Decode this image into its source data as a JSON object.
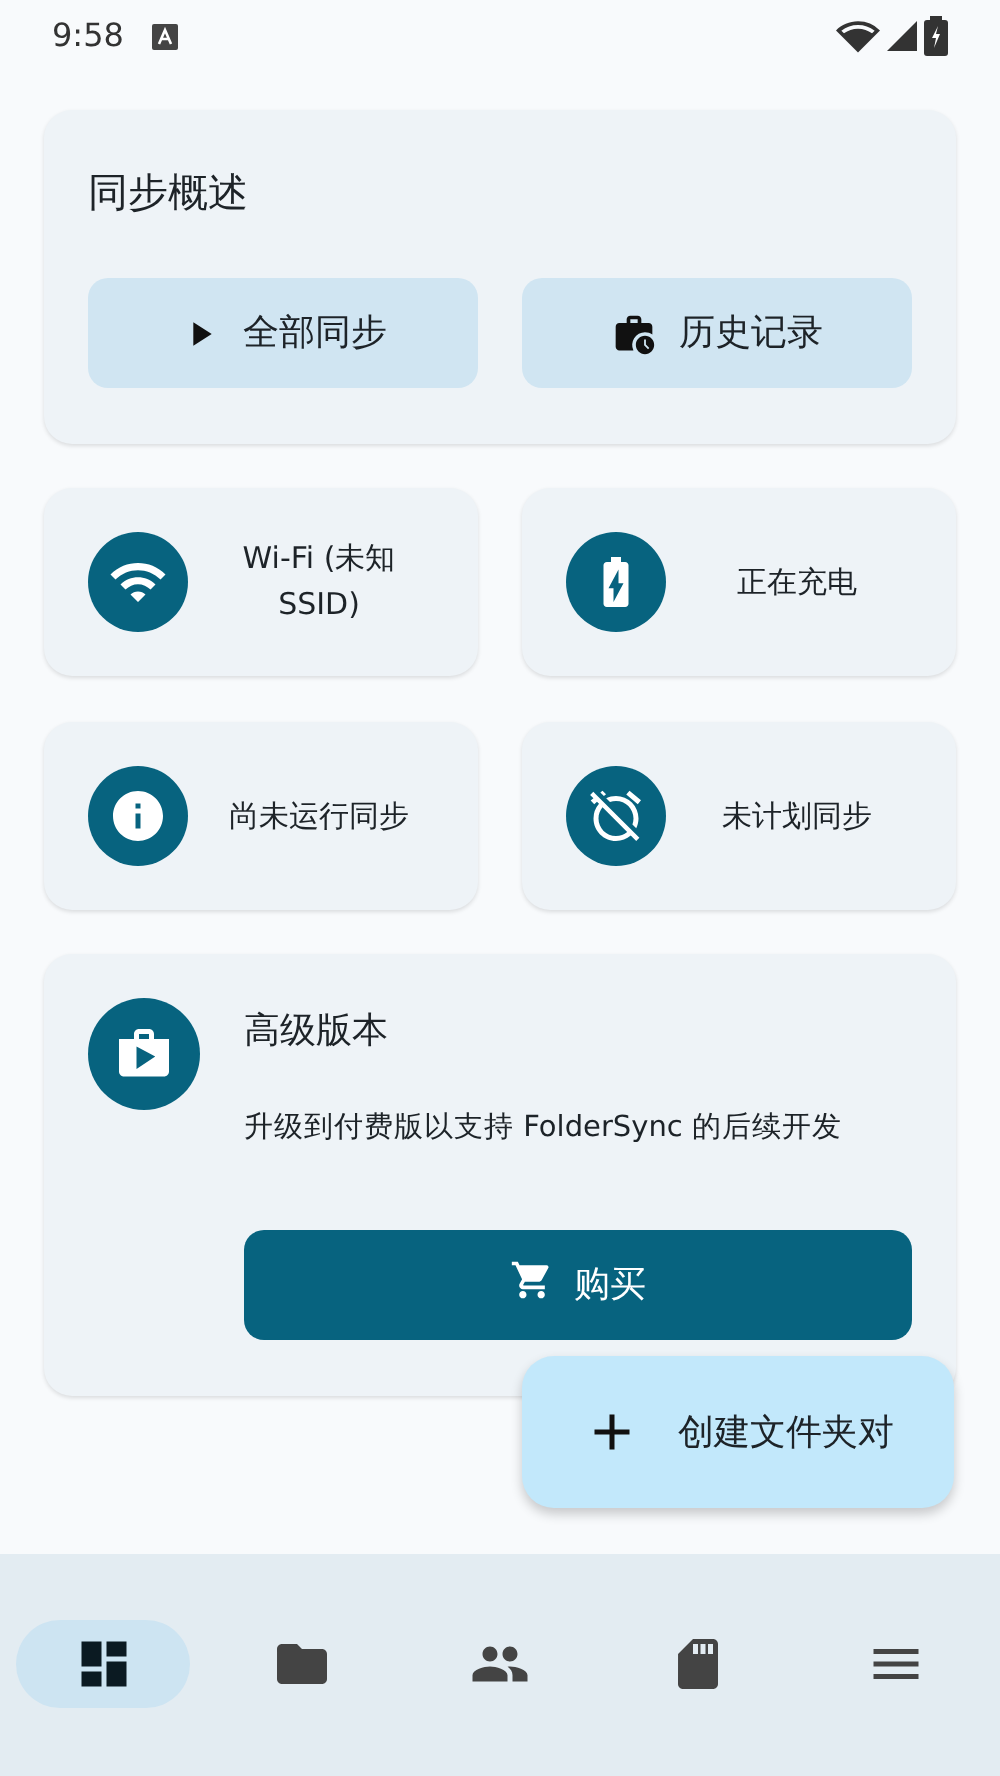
{
  "status_bar": {
    "time": "9:58"
  },
  "overview": {
    "title": "同步概述",
    "buttons": [
      {
        "label": "全部同步"
      },
      {
        "label": "历史记录"
      }
    ]
  },
  "status_cards": [
    {
      "text": "Wi-Fi (未知 SSID)"
    },
    {
      "text": "正在充电"
    },
    {
      "text": "尚未运行同步"
    },
    {
      "text": "未计划同步"
    }
  ],
  "premium": {
    "title": "高级版本",
    "description": "升级到付费版以支持 FolderSync 的后续开发",
    "button": "购买"
  },
  "fab": {
    "label": "创建文件夹对"
  },
  "bottom_nav": [
    {
      "selected": true
    },
    {
      "selected": false
    },
    {
      "selected": false
    },
    {
      "selected": false
    },
    {
      "selected": false
    }
  ]
}
